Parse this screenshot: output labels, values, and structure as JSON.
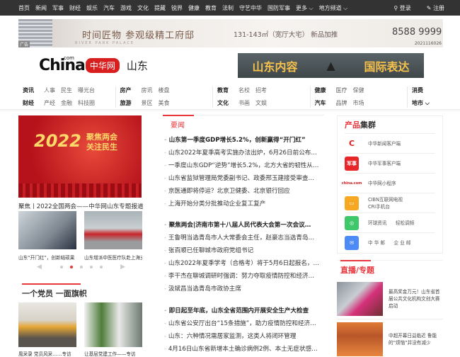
{
  "topnav": {
    "items": [
      "首页",
      "新闻",
      "军事",
      "财经",
      "娱乐",
      "汽车",
      "游戏",
      "文化",
      "提藏",
      "锐界",
      "健康",
      "教育",
      "法制",
      "守艺中华",
      "国防军事",
      "更多 ⌵",
      "地方频道 ⌵"
    ],
    "login": "登录",
    "register": "注册"
  },
  "ad": {
    "headline": "时间匠物  参观级精工府邸",
    "area": "131-143㎡（宽厅大宅） 新品加推",
    "phone": "8588 9999",
    "tag": "广告",
    "subtitle": "RIVER PARK PALACE",
    "date": "2021116026"
  },
  "logo": {
    "china": "China",
    "com": "com",
    "brand": "中华网",
    "province": "山东"
  },
  "banner2": {
    "left": "山东内容",
    "right": "国际表达"
  },
  "catnav": [
    {
      "rows": [
        [
          "资讯",
          "人事",
          "民生",
          "曝光台"
        ],
        [
          "财经",
          "产经",
          "金融",
          "科技圈"
        ]
      ]
    },
    {
      "rows": [
        [
          "房产",
          "房讯",
          "楼盘",
          ""
        ],
        [
          "旅游",
          "景区",
          "美食",
          ""
        ]
      ]
    },
    {
      "rows": [
        [
          "教育",
          "名校",
          "招考",
          ""
        ],
        [
          "文化",
          "书画",
          "文娱",
          ""
        ]
      ]
    },
    {
      "rows": [
        [
          "健康",
          "医疗",
          "保健",
          ""
        ],
        [
          "汽车",
          "品牌",
          "市场",
          ""
        ]
      ]
    },
    {
      "rows": [
        [
          "消费"
        ],
        [
          "地市 ⌵"
        ]
      ]
    }
  ],
  "hero": {
    "year": "2022",
    "title": "聚焦两会\n关注民生",
    "caption": "聚焦丨2022全国两会——中华网山东专题报道"
  },
  "thumbs": [
    {
      "caption": "山东“开门红”，创新结硕果"
    },
    {
      "caption": "山东增派中医医疗队赴上海支"
    }
  ],
  "carousel": {
    "prev": "◀",
    "next": "▶",
    "count": 5,
    "active": 2
  },
  "party": {
    "title": "一个党员 一面旗帜",
    "captions": [
      "風采录 党员风采……专访",
      "让基层党建工作——专访"
    ]
  },
  "yaowen": {
    "title": "要闻",
    "items": [
      {
        "t": "山东第一季度GDP增长5.2%，创新赢得“开门红”",
        "b": true
      },
      {
        "t": "山东2022年夏季高考实施办法出炉，6月26日前公布…"
      },
      {
        "t": "一季度山东GDP“逆势”增长5.2%，北方大省的韧性从…"
      },
      {
        "t": "山东省监狱管理局党委副书记、政委邢玉建接受审查…"
      },
      {
        "t": "京医通即将停运？北京卫健委、北京银行回应"
      },
      {
        "t": "上海开始分类分批推动企业复工复产"
      },
      {
        "t": "聚焦两会|济南市第十八届人民代表大会第一次会议…",
        "b": true
      },
      {
        "t": "王鲁明当选青岛市人大常委会主任，赵豪志当选青岛…"
      },
      {
        "t": "张百顺已任聊城市政府党组书记"
      },
      {
        "t": "山东2022年夏季学考（合格考）将于5月6日起报名，…"
      },
      {
        "t": "李干杰在聊城调研时强调：努力夺取疫情防控和经济…"
      },
      {
        "t": "汲斌昌当选青岛市政协主席"
      },
      {
        "t": "即日起至年底，山东全省范围内开展安全生产大检查",
        "b": true
      },
      {
        "t": "山东省公安厅出台“15条措施”，助力疫情防控和经济…"
      },
      {
        "t": "山东：六种情况需居家监测，这类人将闭环管理"
      },
      {
        "t": "4月16日山东省新增本土确诊病例2例、本土无症状感…"
      }
    ]
  },
  "products": {
    "title_red": "产品",
    "title_dark": "集群",
    "items": [
      {
        "icon": "china-app-icon",
        "label": "中华新闻客户端",
        "color": "#ffffff",
        "glyph": "C"
      },
      {
        "icon": "military-app-icon",
        "label": "中华军事客户端",
        "color": "#e8262a",
        "glyph": "军事"
      },
      {
        "icon": "mini-program-icon",
        "label": "中华网小程序",
        "color": "#ffffff",
        "glyph": "china.com"
      },
      {
        "icon": "tv-icon",
        "label": "CIBN互联网电视\nCRI手机台",
        "color": "#f7a823",
        "glyph": "▭"
      },
      {
        "icon": "radio-icon",
        "label": "环球资讯      轻松调频",
        "color": "#3fc86a",
        "glyph": "◎"
      },
      {
        "icon": "mail-icon",
        "label": "中 华 邮      企 业 邮",
        "color": "#4c8bf5",
        "glyph": "✉"
      }
    ]
  },
  "live": {
    "title": "直播/专题",
    "items": [
      {
        "t": "最高奖金万元！山东省首届公共文化机构文创大赛启动"
      },
      {
        "t": "中超开幕日益临近 鲁能的“烦恼”并没有减少"
      }
    ]
  },
  "colors": {
    "accent": "#e8383d",
    "topbar": "#333333"
  }
}
